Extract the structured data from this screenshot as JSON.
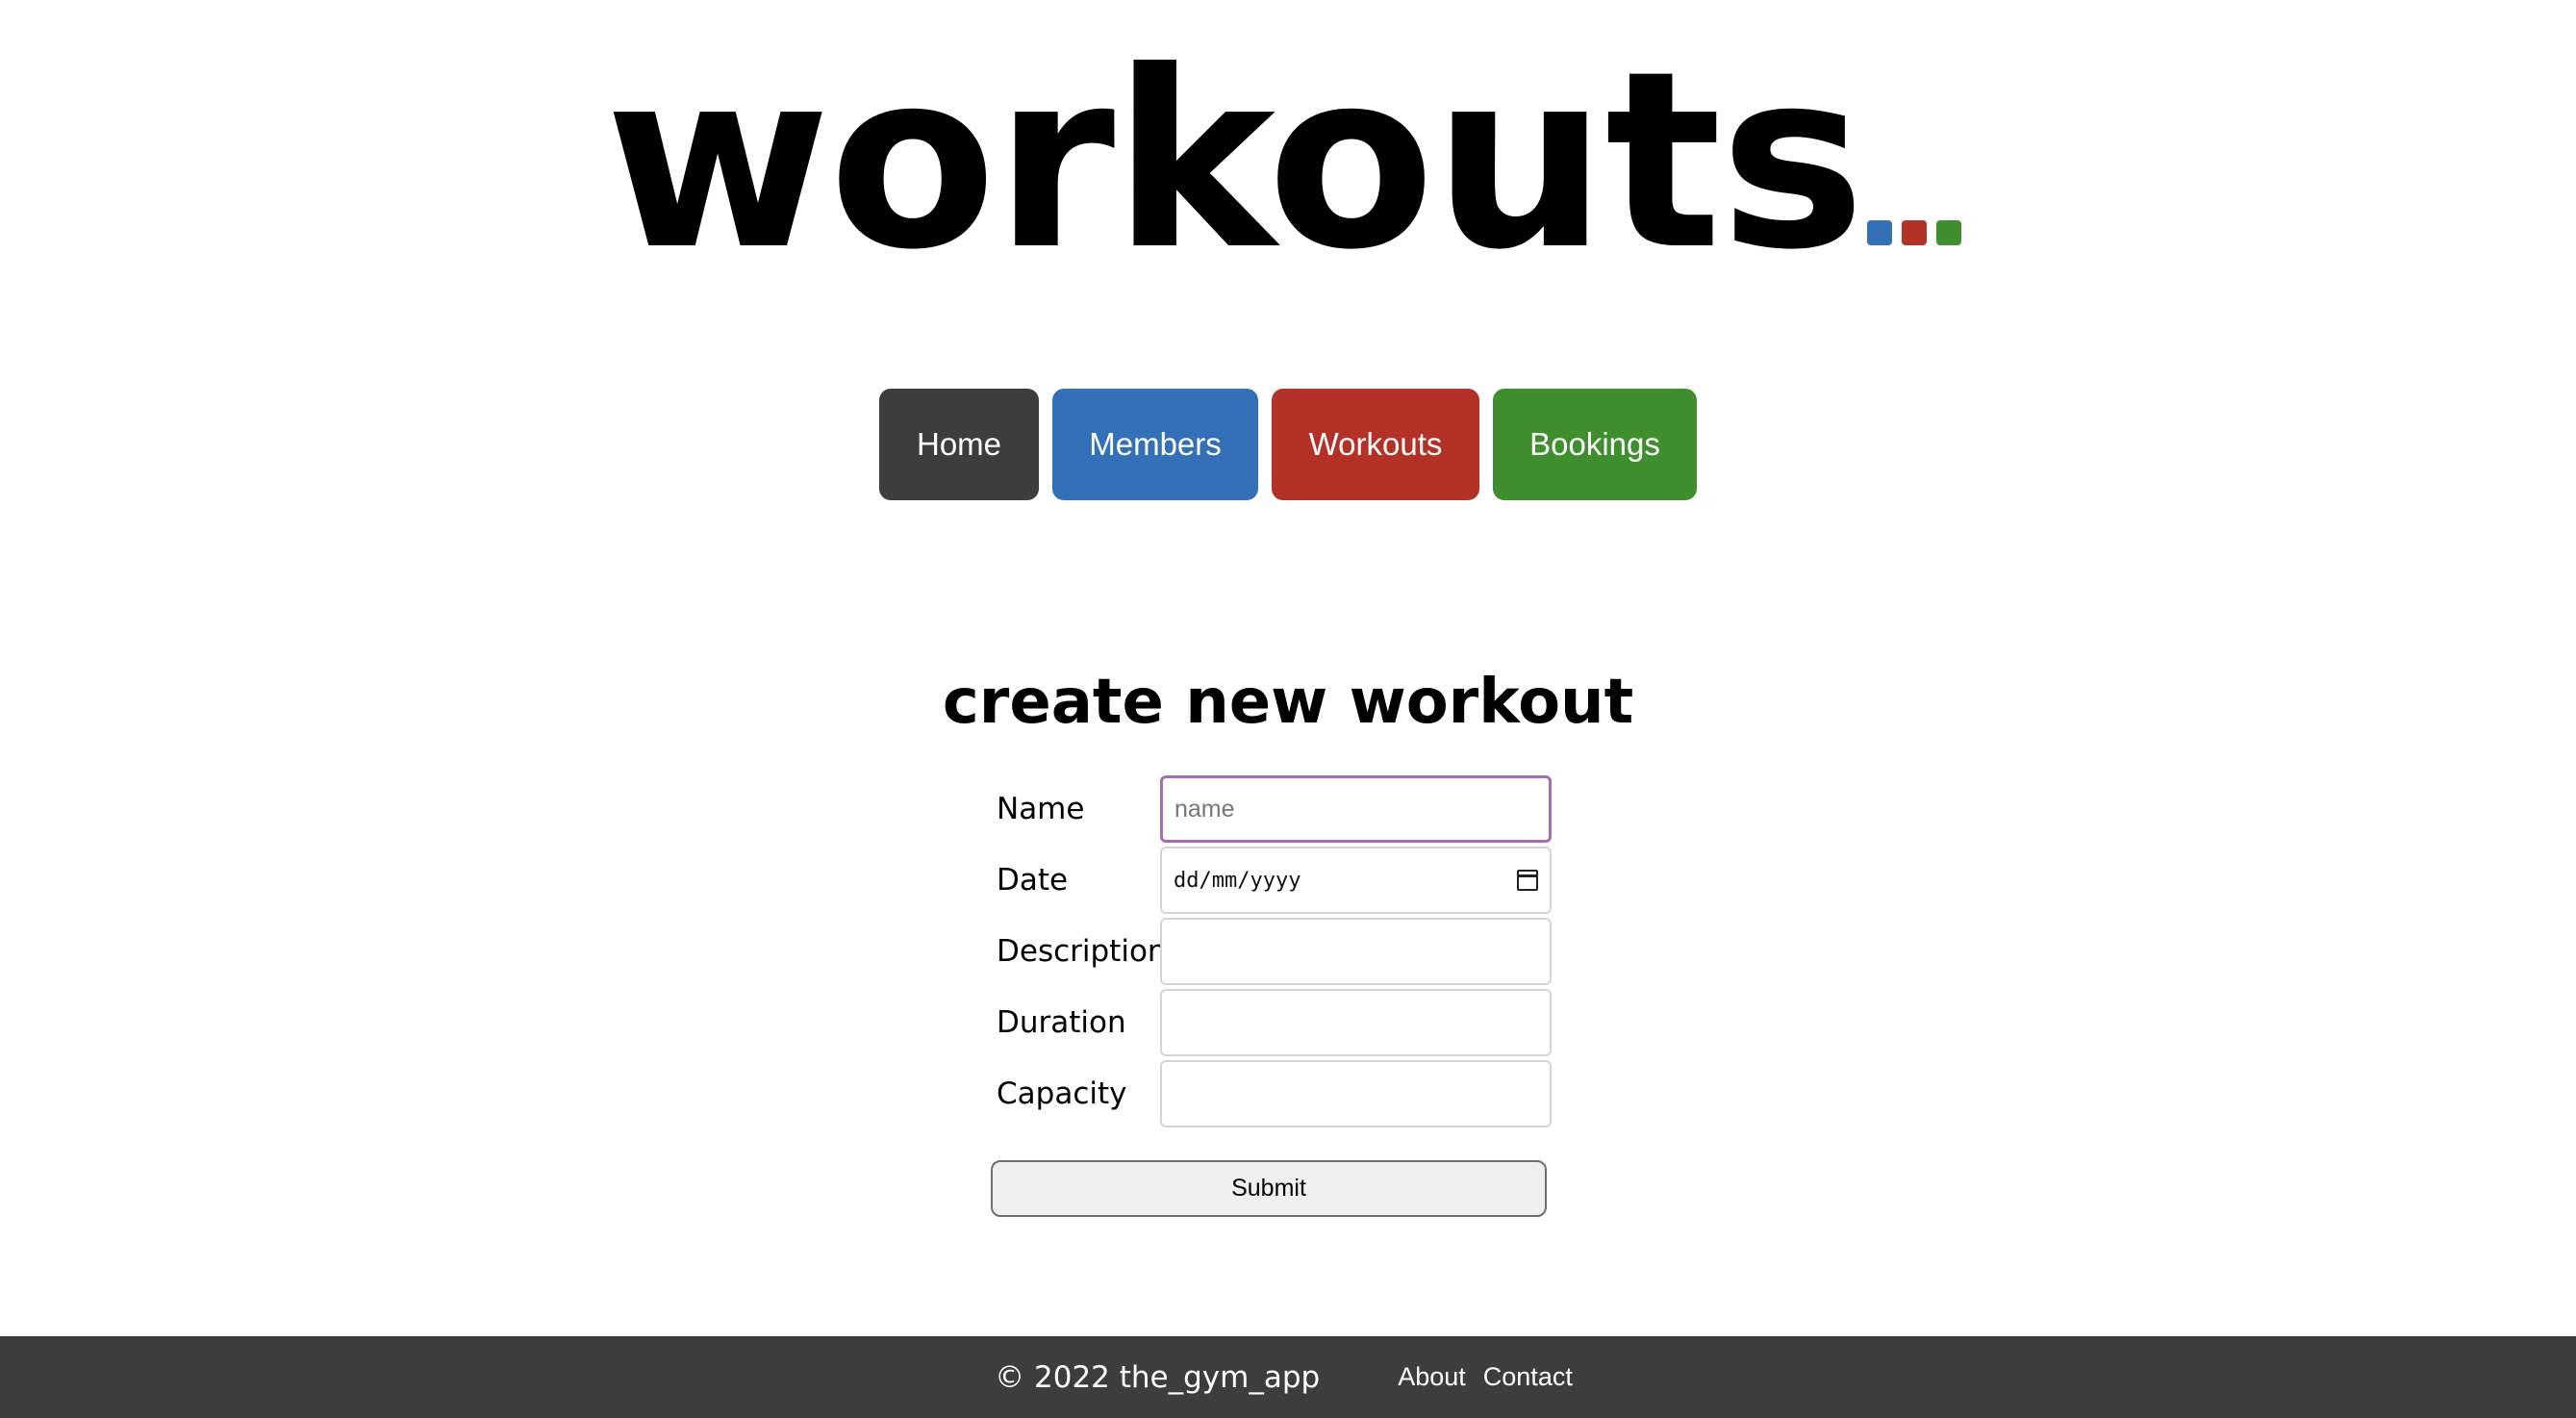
{
  "logo": {
    "text": "workouts",
    "dot_colors": [
      "#3370b7",
      "#b33127",
      "#3f8f2e"
    ]
  },
  "nav": {
    "items": [
      {
        "label": "Home",
        "color": "#3d3d3d"
      },
      {
        "label": "Members",
        "color": "#3370b7"
      },
      {
        "label": "Workouts",
        "color": "#b33127"
      },
      {
        "label": "Bookings",
        "color": "#3f8f2e"
      }
    ]
  },
  "form": {
    "title": "create new workout",
    "fields": [
      {
        "label": "Name",
        "placeholder": "name",
        "value": ""
      },
      {
        "label": "Date",
        "placeholder": "dd/mm/yyyy",
        "value": ""
      },
      {
        "label": "Description",
        "placeholder": "",
        "value": ""
      },
      {
        "label": "Duration",
        "placeholder": "",
        "value": ""
      },
      {
        "label": "Capacity",
        "placeholder": "",
        "value": ""
      }
    ],
    "submit_label": "Submit",
    "focus_color": "#a76db3"
  },
  "footer": {
    "copyright": "© 2022 the_gym_app",
    "links": [
      "About",
      "Contact"
    ],
    "background": "#3d3d3d"
  }
}
